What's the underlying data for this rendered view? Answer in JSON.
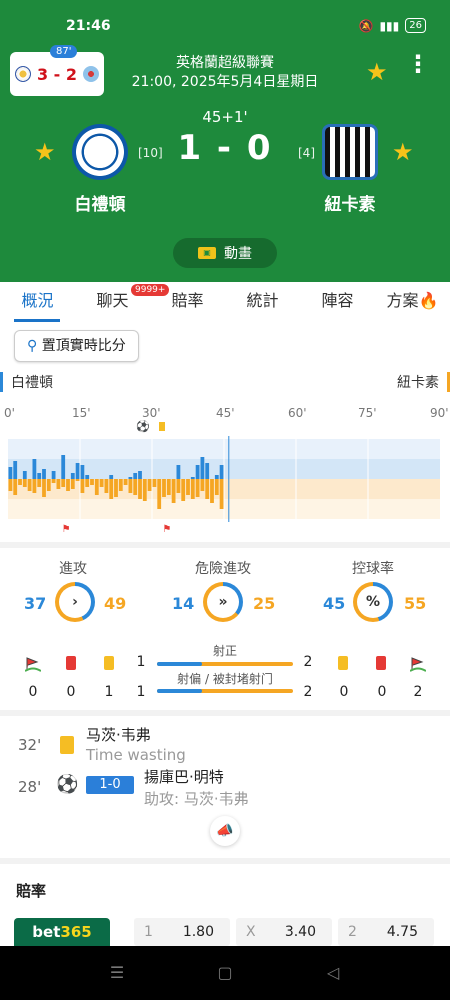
{
  "statusbar": {
    "time": "21:46",
    "battery": "26"
  },
  "mini_score": {
    "minute": "87'",
    "score": "3 - 2"
  },
  "match": {
    "league": "英格蘭超級聯賽",
    "datetime": "21:00, 2025年5月4日星期日",
    "minute": "45+1'",
    "score": "1 - 0",
    "home": {
      "name": "白禮頓",
      "rank": "[10]"
    },
    "away": {
      "name": "紐卡素",
      "rank": "[4]"
    },
    "animation_label": "動畫"
  },
  "tabs": [
    {
      "label": "概況"
    },
    {
      "label": "聊天",
      "badge": "9999+"
    },
    {
      "label": "賠率"
    },
    {
      "label": "統計"
    },
    {
      "label": "陣容"
    },
    {
      "label": "方案"
    }
  ],
  "live": {
    "pin_label": "置頂實時比分",
    "home_team": "白禮頓",
    "away_team": "紐卡素",
    "ticks": [
      "0'",
      "15'",
      "30'",
      "45'",
      "60'",
      "75'",
      "90'"
    ]
  },
  "chart_data": {
    "type": "bar",
    "x_range": [
      0,
      90
    ],
    "current_minute": 46,
    "home_pressure": [
      0.3,
      0.45,
      0,
      0.2,
      0,
      0.5,
      0.15,
      0.25,
      0,
      0.2,
      0,
      0.6,
      0,
      0.15,
      0.4,
      0.35,
      0.1,
      0,
      0,
      0,
      0,
      0.1,
      0,
      0,
      0,
      0.05,
      0.15,
      0.2,
      0,
      0,
      0,
      0,
      0,
      0,
      0,
      0.35,
      0,
      0,
      0.05,
      0.35,
      0.55,
      0.4,
      0,
      0.1,
      0.35
    ],
    "away_pressure": [
      0.3,
      0.4,
      0.15,
      0.2,
      0.3,
      0.35,
      0.2,
      0.45,
      0.3,
      0.1,
      0.25,
      0.2,
      0.3,
      0.25,
      0.05,
      0.35,
      0.2,
      0.15,
      0.4,
      0.2,
      0.35,
      0.5,
      0.45,
      0.3,
      0.15,
      0.35,
      0.4,
      0.5,
      0.55,
      0.3,
      0.2,
      0.75,
      0.45,
      0.4,
      0.6,
      0.35,
      0.55,
      0.4,
      0.5,
      0.45,
      0.3,
      0.5,
      0.6,
      0.4,
      0.75
    ],
    "events": [
      {
        "minute": 28,
        "type": "goal"
      },
      {
        "minute": 32,
        "type": "yellow"
      },
      {
        "minute": 12,
        "type": "corner"
      },
      {
        "minute": 33,
        "type": "corner"
      }
    ]
  },
  "stats": {
    "attack": {
      "label": "進攻",
      "home": "37",
      "away": "49",
      "home_share": 0.43
    },
    "danger": {
      "label": "危險進攻",
      "home": "14",
      "away": "25",
      "home_share": 0.36
    },
    "possession": {
      "label": "控球率",
      "home": "45",
      "away": "55",
      "home_share": 0.45
    },
    "shots_on": {
      "label": "射正",
      "home": "1",
      "away": "2",
      "home_share": 0.33
    },
    "shots_off": {
      "label": "射偏 / 被封堵射门",
      "home": "1",
      "away": "2",
      "home_share": 0.33
    },
    "home_counts": {
      "corners": "0",
      "red": "0",
      "yellow": "1"
    },
    "away_counts": {
      "yellow": "0",
      "red": "0",
      "corners": "2"
    }
  },
  "events": [
    {
      "minute": "32'",
      "player": "马茨·韦弗",
      "detail": "Time wasting"
    },
    {
      "minute": "28'",
      "score": "1-0",
      "player": "揚庫巴·明特",
      "assist": "助攻: 马茨·韦弗"
    }
  ],
  "odds": {
    "title": "賠率",
    "bookmaker": {
      "main": "bet",
      "accent": "365"
    },
    "items": [
      {
        "key": "1",
        "value": "1.80"
      },
      {
        "key": "X",
        "value": "3.40"
      },
      {
        "key": "2",
        "value": "4.75"
      }
    ]
  },
  "colors": {
    "green": "#1e8a3c",
    "home_blue": "#2b88d8",
    "away_orange": "#f5a623",
    "tab_blue": "#1a73c8"
  }
}
